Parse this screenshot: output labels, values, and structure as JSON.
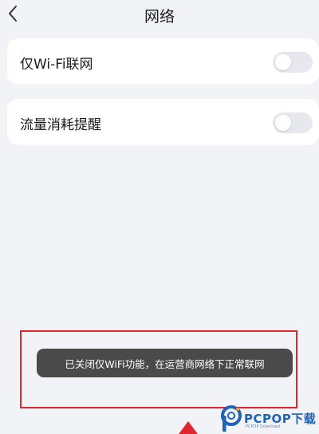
{
  "header": {
    "title": "网络",
    "back_icon": "chevron-left-icon"
  },
  "settings": [
    {
      "label": "仅Wi-Fi联网",
      "enabled": false
    },
    {
      "label": "流量消耗提醒",
      "enabled": false
    }
  ],
  "toast": {
    "message": "已关闭仅WiFi功能，在运营商网络下正常联网"
  },
  "watermark": {
    "brand": "PCPOP下载",
    "tagline": "PCPOP Download"
  },
  "colors": {
    "background": "#f2f3f7",
    "card": "#ffffff",
    "toggle_off": "#e6e8ee",
    "toast_bg": "#4a4a4a",
    "highlight": "#e0262f",
    "brand_blue": "#1e63b8"
  }
}
